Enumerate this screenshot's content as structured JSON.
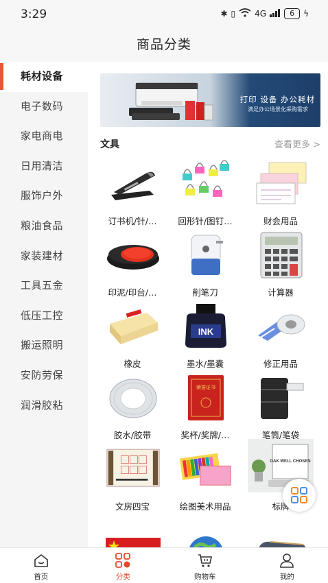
{
  "status_bar": {
    "time": "3:29",
    "signal": "4G",
    "battery": "6"
  },
  "header": {
    "title": "商品分类"
  },
  "sidebar": {
    "items": [
      {
        "label": "耗材设备",
        "active": true
      },
      {
        "label": "电子数码"
      },
      {
        "label": "家电商电"
      },
      {
        "label": "日用清洁"
      },
      {
        "label": "服饰户外"
      },
      {
        "label": "粮油食品"
      },
      {
        "label": "家装建材"
      },
      {
        "label": "工具五金"
      },
      {
        "label": "低压工控"
      },
      {
        "label": "搬运照明"
      },
      {
        "label": "安防劳保"
      },
      {
        "label": "润滑胶粘"
      }
    ]
  },
  "banner": {
    "headline": "打印 设备 办公耗材",
    "subline": "满足办公场景化采购需求"
  },
  "section": {
    "title": "文具",
    "more": "查看更多 >"
  },
  "products": [
    {
      "label": "订书机/针/…",
      "icon": "stapler-icon"
    },
    {
      "label": "回形针/图钉…",
      "icon": "paper-clip-icon"
    },
    {
      "label": "财会用品",
      "icon": "invoice-icon"
    },
    {
      "label": "印泥/印台/…",
      "icon": "ink-pad-icon"
    },
    {
      "label": "削笔刀",
      "icon": "pencil-sharpener-icon"
    },
    {
      "label": "计算器",
      "icon": "calculator-icon"
    },
    {
      "label": "橡皮",
      "icon": "eraser-icon"
    },
    {
      "label": "墨水/墨囊",
      "icon": "ink-bottle-icon"
    },
    {
      "label": "修正用品",
      "icon": "correction-tape-icon"
    },
    {
      "label": "胶水/胶带",
      "icon": "tape-roll-icon"
    },
    {
      "label": "奖杯/奖牌/…",
      "icon": "certificate-icon"
    },
    {
      "label": "笔筒/笔袋",
      "icon": "pen-holder-icon"
    },
    {
      "label": "文房四宝",
      "icon": "calligraphy-set-icon"
    },
    {
      "label": "绘图美术用品",
      "icon": "crayons-icon"
    },
    {
      "label": "标牌",
      "icon": "sign-board-icon"
    },
    {
      "label": "",
      "icon": "flag-icon"
    },
    {
      "label": "",
      "icon": "globe-icon"
    },
    {
      "label": "",
      "icon": "pencil-case-icon"
    }
  ],
  "image_text": {
    "ink_bottle": "INK",
    "certificate": "荣誉证书",
    "sign_board": "OAK WELL CHOSEN"
  },
  "tabbar": {
    "items": [
      {
        "label": "首页",
        "icon": "home-icon"
      },
      {
        "label": "分类",
        "icon": "category-icon",
        "active": true
      },
      {
        "label": "购物车",
        "icon": "cart-icon"
      },
      {
        "label": "我的",
        "icon": "user-icon"
      }
    ]
  },
  "colors": {
    "accent": "#e6582f",
    "active_tab": "#e24a2a",
    "sidebar_bg": "#f5f5f5",
    "muted": "#999999"
  }
}
